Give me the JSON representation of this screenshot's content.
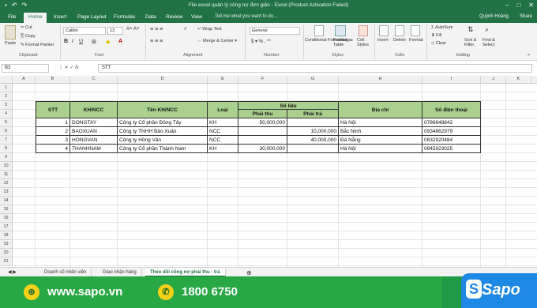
{
  "window": {
    "title": "File excel quản lý công nợ đơn giản - Excel (Product Activation Failed)"
  },
  "tabs": [
    "File",
    "Home",
    "Insert",
    "Page Layout",
    "Formulas",
    "Data",
    "Review",
    "View"
  ],
  "tell_me": "Tell me what you want to do...",
  "user": "Quỳnh Hoàng",
  "share": "Share",
  "ribbon": {
    "clipboard": {
      "paste": "Paste",
      "cut": "Cut",
      "copy": "Copy",
      "format_painter": "Format Painter",
      "label": "Clipboard"
    },
    "font": {
      "name": "Calibri",
      "size": "13",
      "label": "Font"
    },
    "alignment": {
      "wrap": "Wrap Text",
      "merge": "Merge & Center",
      "label": "Alignment"
    },
    "number": {
      "format": "General",
      "label": "Number"
    },
    "styles": {
      "conditional": "Conditional Formatting",
      "format_table": "Format as Table",
      "cell_styles": "Cell Styles",
      "label": "Styles"
    },
    "cells": {
      "insert": "Insert",
      "delete": "Delete",
      "format": "Format",
      "label": "Cells"
    },
    "editing": {
      "autosum": "AutoSum",
      "fill": "Fill",
      "clear": "Clear",
      "sort": "Sort & Filter",
      "find": "Find & Select",
      "label": "Editing"
    }
  },
  "formula_bar": {
    "name_box": "B3",
    "fx": "fx",
    "content": "STT"
  },
  "columns": [
    "A",
    "B",
    "C",
    "D",
    "E",
    "F",
    "G",
    "H",
    "I",
    "J",
    "K"
  ],
  "rows": [
    "1",
    "2",
    "3",
    "4",
    "5",
    "6",
    "7",
    "8",
    "9",
    "10",
    "11",
    "12",
    "13",
    "14",
    "15",
    "16",
    "17",
    "18",
    "19",
    "20",
    "21"
  ],
  "table": {
    "headers": {
      "stt": "STT",
      "khncc": "KH/NCC",
      "ten": "Tên KH/NCC",
      "loai": "Loại",
      "solieu": "Số liệu",
      "phaithu": "Phải thu",
      "phaitra": "Phải trả",
      "diachi": "Địa chỉ",
      "sdt": "Số điện thoại"
    },
    "rows": [
      {
        "stt": "1",
        "code": "DONGTAY",
        "name": "Công ty Cổ phần Đông Tây",
        "type": "KH",
        "thu": "50,000,000",
        "tra": "",
        "addr": "Hà Nội",
        "phone": "0786648842"
      },
      {
        "stt": "2",
        "code": "BAOXUAN",
        "name": "Công ty TNHH Bảo Xuân",
        "type": "NCC",
        "thu": "",
        "tra": "10,000,000",
        "addr": "Bắc Ninh",
        "phone": "0934862979"
      },
      {
        "stt": "3",
        "code": "HONGVAN",
        "name": "Công ty Hồng Vân",
        "type": "NCC",
        "thu": "",
        "tra": "40,000,000",
        "addr": "Đà Nẵng",
        "phone": "0832920484"
      },
      {
        "stt": "4",
        "code": "THANHNAM",
        "name": "Công ty Cổ phần Thành Nam",
        "type": "KH",
        "thu": "30,000,000",
        "tra": "",
        "addr": "Hà Nội",
        "phone": "0845923025"
      }
    ]
  },
  "sheets": [
    "Doanh số nhân viên",
    "Giao nhận hàng",
    "Theo dõi công nợ phải thu - trả"
  ],
  "banner": {
    "website": "www.sapo.vn",
    "phone": "1800 6750",
    "brand": "Sapo"
  },
  "colors": {
    "excel_green": "#217346",
    "header_fill": "#a9d08e",
    "banner_green": "#28a745",
    "sapo_blue": "#1e88e5"
  }
}
